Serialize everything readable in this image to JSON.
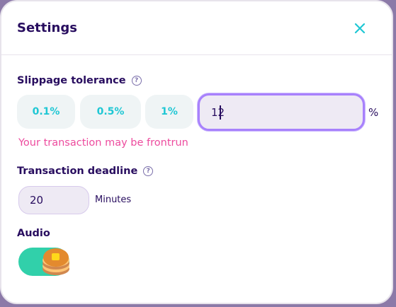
{
  "modal": {
    "title": "Settings"
  },
  "slippage": {
    "label": "Slippage tolerance",
    "presets": [
      "0.1%",
      "0.5%",
      "1%"
    ],
    "custom_value": "12",
    "unit": "%",
    "warning": "Your transaction may be frontrun"
  },
  "deadline": {
    "label": "Transaction deadline",
    "value": "20",
    "unit": "Minutes"
  },
  "audio": {
    "label": "Audio",
    "enabled": true
  },
  "colors": {
    "primary_text": "#280d5f",
    "accent": "#1fc7d4",
    "warning": "#ed4b9e",
    "toggle_on": "#31d0aa",
    "input_focus": "#a881fc"
  },
  "icons": [
    "close-icon",
    "help-icon",
    "pancake-icon"
  ]
}
